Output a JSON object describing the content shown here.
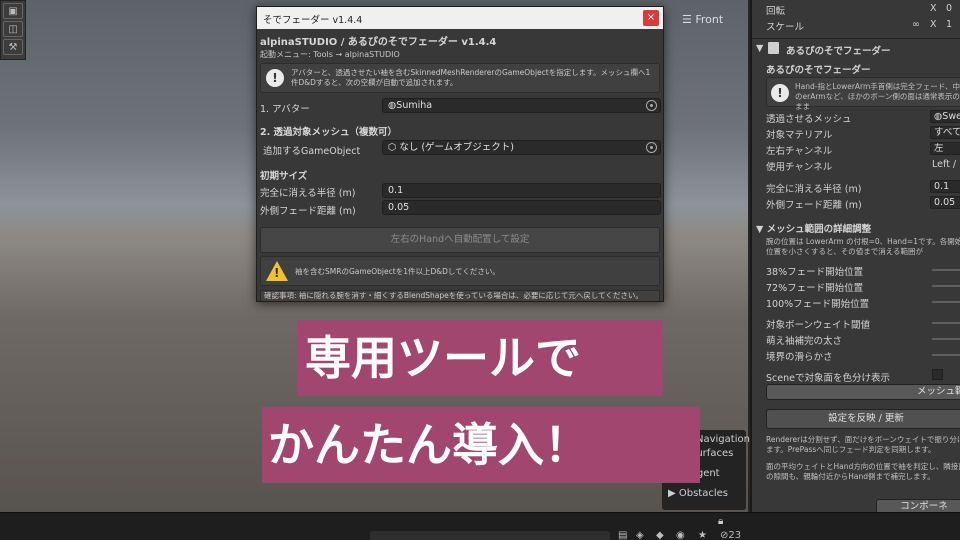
{
  "scene": {
    "gizmo_label": "Front"
  },
  "nav_panel": {
    "items": [
      "Navigation",
      "Surfaces",
      "Agent",
      "Obstacles"
    ]
  },
  "bottom_bar": {
    "lock": "a",
    "count": "23"
  },
  "dialog": {
    "window_title": "そでフェーダー v1.4.4",
    "close_glyph": "×",
    "header": "alpinaSTUDIO / あるぴのそでフェーダー v1.4.4",
    "menu_path": "起動メニュー: Tools → alpinaSTUDIO",
    "intro_help": "アバターと、透過させたい袖を含むSkinnedMeshRendererのGameObjectを指定します。メッシュ欄へ1件D&Dすると、次の空欄が自動で追加されます。",
    "avatar_label": "1. アバター",
    "avatar_value": "Sumiha",
    "mesh_section": "2. 透過対象メッシュ（複数可）",
    "add_go_label": "追加するGameObject",
    "add_go_value": "なし (ゲームオブジェクト)",
    "initial_size": "初期サイズ",
    "full_fade_label": "完全に消える半径 (m)",
    "full_fade_value": "0.1",
    "outer_fade_label": "外側フェード距離 (m)",
    "outer_fade_value": "0.05",
    "auto_place_button": "左右のHandへ自動配置して設定",
    "warning": "袖を含むSMRのGameObjectを1件以上D&Dしてください。",
    "note": "確認事項: 袖に隠れる腕を消す・細くするBlendShapeを使っている場合は、必要に応じて元へ戻してください。"
  },
  "inspector": {
    "rotation_label": "回転",
    "rotation_axis": "X",
    "rotation_value": "0",
    "scale_label": "スケール",
    "scale_axis": "X",
    "scale_value": "1",
    "component_title": "あるぴのそでフェーダー",
    "component_subtitle": "あるぴのそでフェーダー",
    "help1": "Hand-指とLowerArm手首側は完全フェード、中のerArmなど、ほかのボーン側の面は通常表示のまま",
    "mesh_label": "透過させるメッシュ",
    "mesh_value": "Swe",
    "material_label": "対象マテリアル",
    "material_value": "すべての",
    "lr_channel_label": "左右チャンネル",
    "lr_channel_value": "左",
    "use_channel_label": "使用チャンネル",
    "use_channel_value": "Left /",
    "full_fade_label": "完全に消える半径 (m)",
    "full_fade_value": "0.1",
    "outer_fade_label": "外側フェード距離 (m)",
    "outer_fade_value": "0.05",
    "detail_section": "メッシュ範囲の詳細調整",
    "detail_help": "腕の位置は LowerArm の付根=0、Hand=1です。各開始位置を小さくすると、その値まで消える範囲が",
    "fade38": "38%フェード開始位置",
    "fade72": "72%フェード開始位置",
    "fade100": "100%フェード開始位置",
    "bone_weight": "対象ボーンウェイト閾値",
    "sleeve_width": "萌え袖補完の太さ",
    "boundary": "境界の滑らかさ",
    "scene_color": "Sceneで対象面を色分け表示",
    "mesh_range_button": "メッシュ範囲",
    "apply_button": "設定を反映 / 更新",
    "help2": "Rendererは分割せず、面だけをボーンウェイトで振り分けます。PrePassへ同じフェード判定を同期します。",
    "help3": "面の平均ウェイトとHand方向の位置で袖を判定し、隣接面の隙間も、親輪付近からHand側まで補完します。",
    "component_button": "コンポーネ"
  },
  "captions": {
    "line1": "専用ツールで",
    "line2": "かんたん導入！"
  },
  "colors": {
    "caption_bg": "#a1466f",
    "dialog_bg": "#383838",
    "warning": "#f2c12e",
    "close_button": "#d83b3b"
  }
}
